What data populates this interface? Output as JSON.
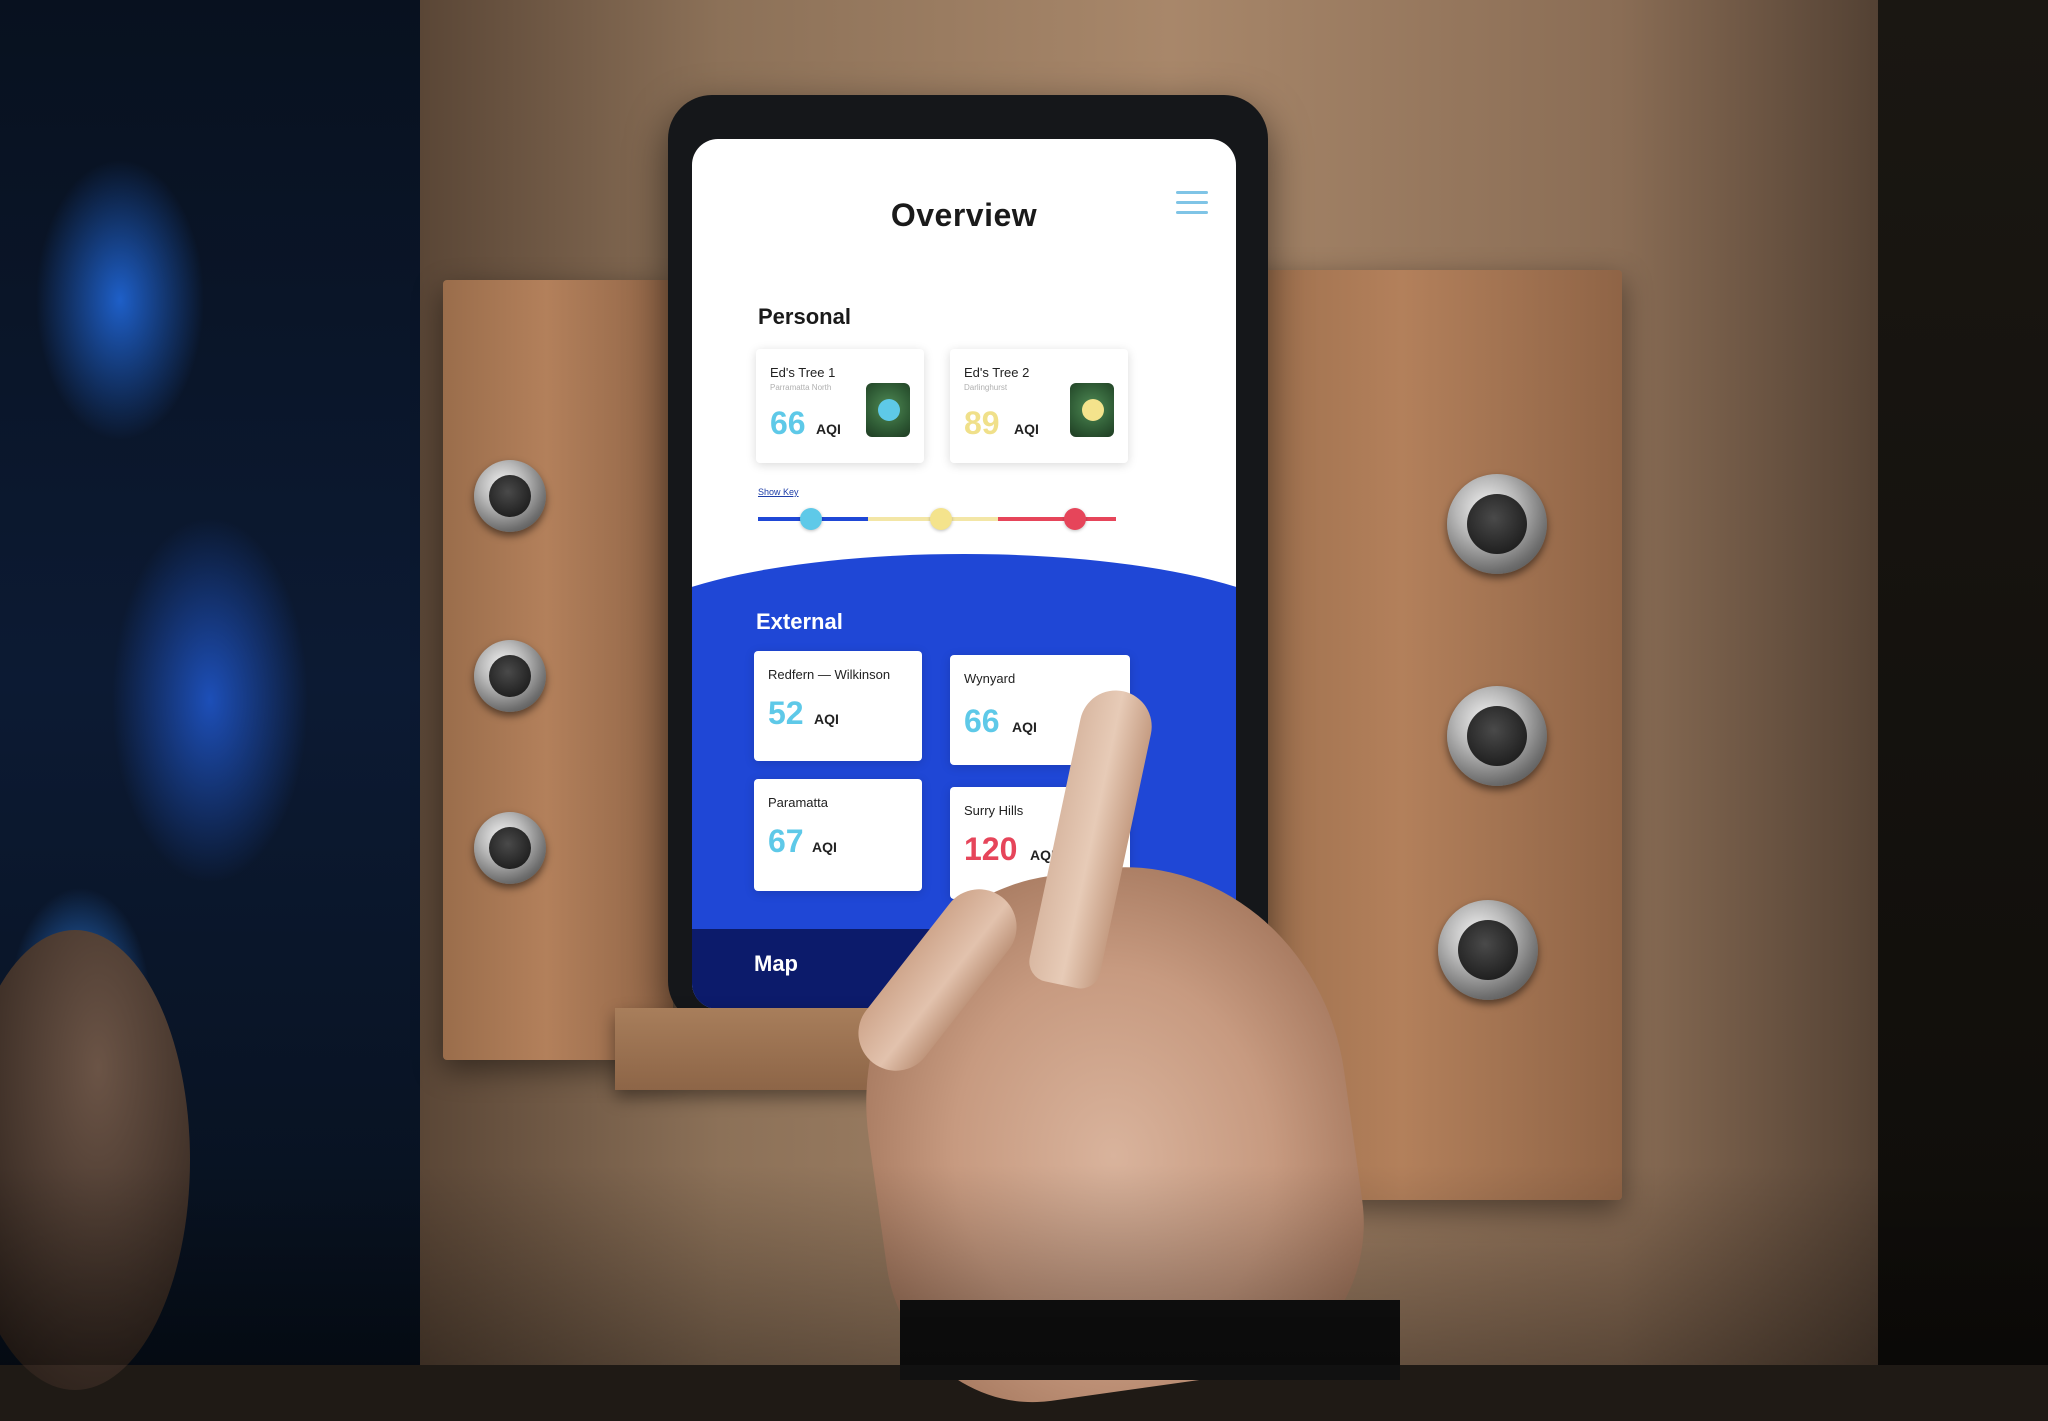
{
  "screen": {
    "title": "Overview",
    "personal": {
      "heading": "Personal",
      "cards": [
        {
          "name": "Ed's Tree 1",
          "location": "Parramatta North",
          "value": "66",
          "unit": "AQI",
          "color": "#5ec9e8"
        },
        {
          "name": "Ed's Tree 2",
          "location": "Darlinghurst",
          "value": "89",
          "unit": "AQI",
          "color": "#f0e08a"
        }
      ]
    },
    "key": {
      "link": "Show Key",
      "colors": {
        "good": "#1f47d6",
        "moderate": "#f3e6a6",
        "poor": "#e6455a",
        "good_dot": "#5ec9e8",
        "moderate_dot": "#f4e38c",
        "poor_dot": "#e6455a"
      }
    },
    "external": {
      "heading": "External",
      "cards": [
        {
          "name": "Redfern — Wilkinson",
          "value": "52",
          "unit": "AQI",
          "color": "#5ec9e8"
        },
        {
          "name": "Wynyard",
          "value": "66",
          "unit": "AQI",
          "color": "#5ec9e8"
        },
        {
          "name": "Paramatta",
          "value": "67",
          "unit": "AQI",
          "color": "#5ec9e8"
        },
        {
          "name": "Surry Hills",
          "value": "120",
          "unit": "AQI",
          "color": "#e6455a"
        }
      ]
    },
    "nav": {
      "map_label": "Map"
    },
    "icons": {
      "menu": "hamburger-menu-icon",
      "tree": "tree-face-icon"
    },
    "accent": "#1f47d6"
  }
}
